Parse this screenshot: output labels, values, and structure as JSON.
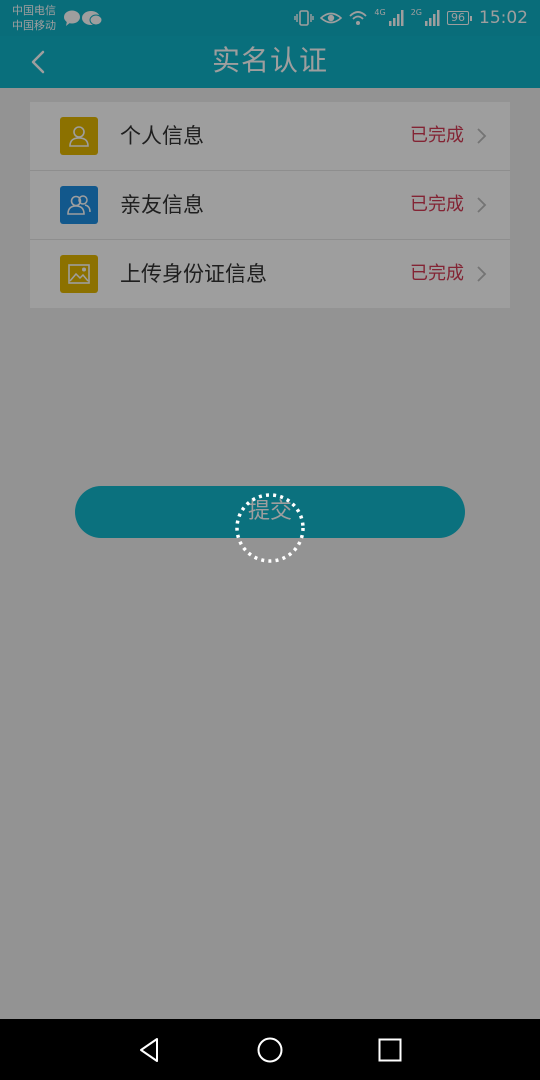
{
  "status_bar": {
    "carrier_1": "中国电信",
    "carrier_2": "中国移动",
    "network_1": "4G",
    "network_2": "2G",
    "battery": "96",
    "time": "15:02"
  },
  "header": {
    "title": "实名认证"
  },
  "items": [
    {
      "label": "个人信息",
      "status": "已完成",
      "icon": "person-icon",
      "icon_color": "#e3b700"
    },
    {
      "label": "亲友信息",
      "status": "已完成",
      "icon": "contacts-icon",
      "icon_color": "#1d8ee3"
    },
    {
      "label": "上传身份证信息",
      "status": "已完成",
      "icon": "image-icon",
      "icon_color": "#e3b700"
    }
  ],
  "submit": {
    "label": "提交"
  },
  "colors": {
    "accent": "#10b3c8",
    "status_done": "#d43a55"
  }
}
